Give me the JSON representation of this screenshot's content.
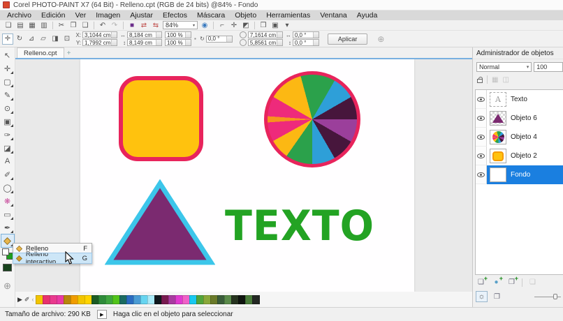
{
  "titlebar": {
    "title": "Corel PHOTO-PAINT X7 (64 Bit) - Relleno.cpt (RGB de 24 bits) @84% - Fondo"
  },
  "menubar": {
    "items": [
      "Archivo",
      "Edición",
      "Ver",
      "Imagen",
      "Ajustar",
      "Efectos",
      "Máscara",
      "Objeto",
      "Herramientas",
      "Ventana",
      "Ayuda"
    ]
  },
  "toolbar": {
    "zoom_value": "84%",
    "icons": [
      {
        "name": "new-document-icon",
        "glyph": "❏"
      },
      {
        "name": "open-icon",
        "glyph": "▤"
      },
      {
        "name": "save-icon",
        "glyph": "▦"
      },
      {
        "name": "print-icon",
        "glyph": "▥"
      },
      {
        "sep": true
      },
      {
        "name": "cut-icon",
        "glyph": "✂"
      },
      {
        "name": "copy-icon",
        "glyph": "❐"
      },
      {
        "name": "paste-icon",
        "glyph": "❑"
      },
      {
        "sep": true
      },
      {
        "name": "undo-icon",
        "glyph": "↶"
      },
      {
        "name": "redo-icon",
        "glyph": "↷",
        "color": "#b0b0b0"
      },
      {
        "sep": true
      },
      {
        "name": "import-icon",
        "glyph": "■",
        "color": "#6b2d8b"
      },
      {
        "name": "export-icon",
        "glyph": "⇄",
        "color": "#c0504d"
      },
      {
        "name": "export-web-icon",
        "glyph": "⇆",
        "color": "#c0504d"
      },
      {
        "type": "zoom"
      },
      {
        "name": "zoom-fit-icon",
        "glyph": "◉",
        "color": "#3a7abf"
      },
      {
        "sep": true
      },
      {
        "name": "grid-icon",
        "glyph": "⌐"
      },
      {
        "name": "snap-icon",
        "glyph": "✛"
      },
      {
        "name": "mask-overlay-icon",
        "glyph": "◩"
      },
      {
        "sep": true
      },
      {
        "name": "image-slicing-icon",
        "glyph": "❒"
      },
      {
        "name": "options-icon",
        "glyph": "▣"
      },
      {
        "name": "toolbar-caret-icon",
        "glyph": "▾"
      }
    ]
  },
  "property_bar": {
    "tools": [
      {
        "name": "position-mode-button",
        "glyph": "✛",
        "active": true
      },
      {
        "name": "rotate-mode-button",
        "glyph": "↻"
      },
      {
        "name": "scale-mode-button",
        "glyph": "⊿"
      },
      {
        "name": "skew-mode-button",
        "glyph": "▱"
      },
      {
        "name": "distort-mode-button",
        "glyph": "◨"
      },
      {
        "name": "perspective-mode-button",
        "glyph": "⊡"
      }
    ],
    "x_label": "X:",
    "x_value": "3,1044 cm",
    "y_label": "Y:",
    "y_value": "1,7992 cm",
    "w_label": "↔",
    "w_value": "8,184 cm",
    "h_label": "↕",
    "h_value": "8,149 cm",
    "sx_value": "100 %",
    "sy_value": "100 %",
    "lock_glyph": "▪",
    "rot_label": "↻",
    "rotation_value": "0,0 °",
    "anchor_x": "7,1614 cm",
    "anchor_y": "5,8561 cm",
    "skew_h_label": "↔",
    "skew_h": "0,0 °",
    "skew_v_label": "↕",
    "skew_v": "0,0 °",
    "apply_label": "Aplicar",
    "nav_glyph": "⊕"
  },
  "document": {
    "tab_label": "Relleno.cpt",
    "new_tab_label": "+"
  },
  "toolbox": {
    "tools": [
      {
        "name": "pick-tool",
        "glyph": "↖"
      },
      {
        "name": "mask-transform-tool",
        "glyph": "✛",
        "flyout": true
      },
      {
        "name": "rectangle-mask-tool",
        "glyph": "▢",
        "flyout": true
      },
      {
        "name": "lasso-mask-tool",
        "glyph": "✎",
        "flyout": true
      },
      {
        "name": "zoom-tool",
        "glyph": "⊙",
        "flyout": true
      },
      {
        "name": "clone-tool",
        "glyph": "▣",
        "flyout": true
      },
      {
        "name": "touch-up-tool",
        "glyph": "✑",
        "flyout": true
      },
      {
        "name": "eraser-tool",
        "glyph": "◪",
        "flyout": true
      },
      {
        "name": "text-tool",
        "glyph": "A"
      },
      {
        "name": "paint-tool",
        "glyph": "✐",
        "flyout": true
      },
      {
        "name": "effect-tool",
        "glyph": "◯",
        "flyout": true
      },
      {
        "name": "image-sprayer-tool",
        "glyph": "❋",
        "color": "#c94f9e",
        "flyout": true
      },
      {
        "name": "rectangle-tool",
        "glyph": "▭",
        "flyout": true
      },
      {
        "name": "eyedropper-tool",
        "glyph": "✒",
        "flyout": true
      },
      {
        "type": "bucket",
        "name": "fill-tool",
        "active": true,
        "flyout": true
      },
      {
        "type": "swatches",
        "name": "color-swatches"
      },
      {
        "type": "canvascolor",
        "name": "canvas-color-swatch"
      }
    ],
    "navigator_glyph": "⊕"
  },
  "canvas": {
    "text_object": "TEXTO",
    "text_color": "#23a323",
    "square": {
      "fill": "#ffc20e",
      "stroke": "#e8245c"
    },
    "wheel_stroke": "#e8245c",
    "triangle": {
      "fill": "#7b2a70",
      "stroke": "#3cc6ea"
    },
    "wheel_sectors": [
      [
        "#2ba14b",
        0,
        30
      ],
      [
        "#2e9fd8",
        30,
        60
      ],
      [
        "#47163c",
        60,
        90
      ],
      [
        "#9b3f9b",
        90,
        120
      ],
      [
        "#47163c",
        120,
        150
      ],
      [
        "#2e9fd8",
        150,
        180
      ],
      [
        "#2ba14b",
        180,
        215
      ],
      [
        "#fcb813",
        215,
        241
      ],
      [
        "#ee2a7b",
        241,
        266
      ],
      [
        "#f7941d",
        266,
        274
      ],
      [
        "#ee2a7b",
        274,
        300
      ],
      [
        "#fcb813",
        300,
        345
      ],
      [
        "#2ba14b",
        345,
        360
      ]
    ]
  },
  "fill_menu": {
    "items": [
      {
        "label": "Relleno",
        "shortcut": "F",
        "highlighted": false
      },
      {
        "label": "Relleno interactivo",
        "shortcut": "G",
        "highlighted": true
      }
    ]
  },
  "palette": {
    "colors": [
      "#f2c500",
      "#e8326e",
      "#e93a8e",
      "#ea3aa4",
      "#b8860b",
      "#f09c00",
      "#f2c500",
      "#ffd400",
      "#1c5c24",
      "#2e8b3a",
      "#3fa53f",
      "#52c41a",
      "#1a6b60",
      "#2a6bc0",
      "#4a9bd4",
      "#66d4f0",
      "#aaeaf8",
      "#10181e",
      "#781a50",
      "#a83aa0",
      "#e03ad0",
      "#f060c8",
      "#18c8f0",
      "#52a43a",
      "#8aa83a",
      "#6a7a2a",
      "#3a5c3a",
      "#5a8a4a",
      "#26331f",
      "#0f140f",
      "#497a39",
      "#232823"
    ]
  },
  "object_manager": {
    "title": "Administrador de objetos",
    "blend_mode": "Normal",
    "opacity": "100",
    "objects": [
      {
        "label": "Texto",
        "thumb": "text",
        "selected": false
      },
      {
        "label": "Objeto 6",
        "thumb": "triangle",
        "selected": false
      },
      {
        "label": "Objeto 4",
        "thumb": "wheel",
        "selected": false
      },
      {
        "label": "Objeto 2",
        "thumb": "square",
        "selected": false
      },
      {
        "label": "Fondo",
        "thumb": "blank",
        "selected": true
      }
    ],
    "selection_color": "#1a7fe0"
  },
  "status_bar": {
    "file_size_label": "Tamaño de archivo: 290 KB",
    "hint": "Haga clic en el objeto para seleccionar"
  }
}
